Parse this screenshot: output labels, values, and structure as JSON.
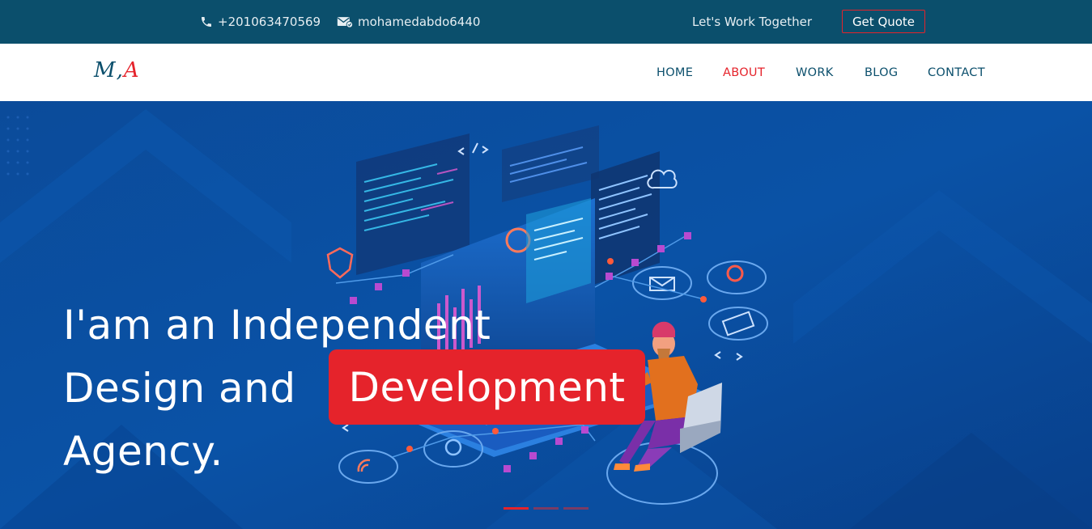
{
  "topbar": {
    "phone": "+201063470569",
    "email": "mohamedabdo6440",
    "tagline": "Let's Work Together",
    "quote_button": "Get Quote",
    "icons": {
      "phone": "phone-icon",
      "email": "email-icon"
    }
  },
  "brand": {
    "logo_m": "M",
    "logo_sep": ",",
    "logo_a": "A"
  },
  "nav": {
    "items": [
      {
        "label": "HOME"
      },
      {
        "label": "ABOUT"
      },
      {
        "label": "WORK"
      },
      {
        "label": "BLOG"
      },
      {
        "label": "CONTACT"
      }
    ],
    "active_index": 1
  },
  "hero": {
    "line1": "I'am an Independent",
    "line2_prefix": "Design and",
    "highlight": "Development",
    "line3": "Agency.",
    "slides": 3,
    "active_slide": 1
  },
  "colors": {
    "topbar": "#0b4f6c",
    "accent": "#e5232b",
    "hero": "#0a4fa0",
    "nav_text": "#0b4f6c"
  }
}
